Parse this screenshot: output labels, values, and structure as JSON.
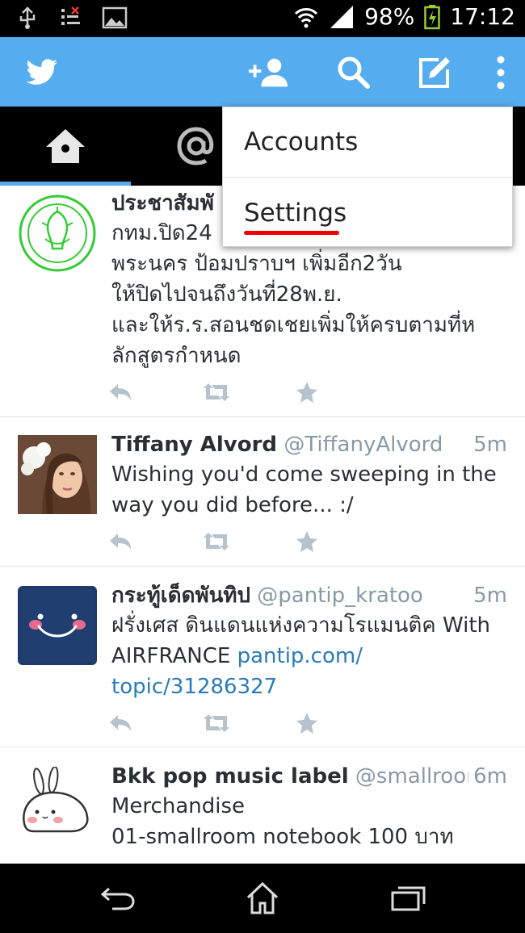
{
  "status_bar": {
    "battery_percent": "98%",
    "time": "17:12"
  },
  "app": {
    "name": "Twitter",
    "brand_color": "#55acee"
  },
  "toolbar": {
    "actions": [
      "add-user-icon",
      "search-icon",
      "compose-icon",
      "overflow-menu-icon"
    ]
  },
  "tabs": [
    {
      "icon": "home-icon",
      "selected": true
    },
    {
      "icon": "at-mention-icon",
      "selected": false
    }
  ],
  "overflow_menu": {
    "items": [
      "Accounts",
      "Settings"
    ],
    "annotated_item": "Settings"
  },
  "tweets": [
    {
      "name": "ประชาสัมพั",
      "handle": "",
      "time": "",
      "lines": [
        "กทม.ปิด24",
        "พระนคร ป้อมปราบฯ เพิ่มอีก2วัน",
        "ให้ปิดไปจนถึงวันที่28พ.ย.",
        "และให้ร.ร.สอนชดเชยเพิ่มให้ครบตามที่ห",
        "ลักสูตรกำหนด"
      ]
    },
    {
      "name": "Tiffany Alvord",
      "handle": "@TiffanyAlvord",
      "time": "5m",
      "lines": [
        "Wishing you'd come sweeping in the",
        "way you did before... :/"
      ]
    },
    {
      "name": "กระทู้เด็ดพันทิป",
      "handle": "@pantip_kratoo",
      "time": "5m",
      "line1": "ฝรั่งเศส ดินแดนแห่งความโรแมนติค With",
      "line2_text": "AIRFRANCE ",
      "line2_link": "pantip.com/",
      "line3_link": "topic/31286327"
    },
    {
      "name": "Bkk pop music label",
      "handle": "@smallroom_t...",
      "time": "6m",
      "lines": [
        "Merchandise",
        "01-smallroom notebook 100 บาท"
      ]
    }
  ],
  "nav_bar": [
    "back-icon",
    "home-icon",
    "recent-apps-icon"
  ]
}
